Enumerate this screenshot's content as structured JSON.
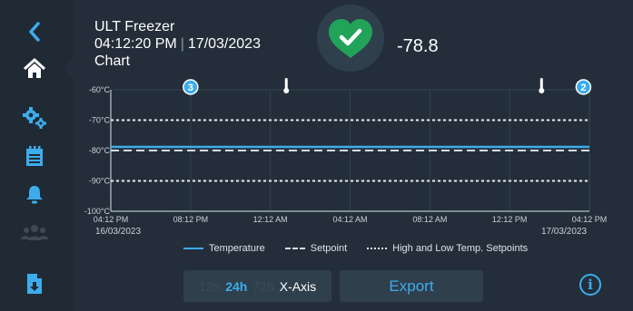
{
  "header": {
    "device_name": "ULT Freezer",
    "time": "04:12:20 PM",
    "separator": "|",
    "date": "17/03/2023",
    "page_title": "Chart"
  },
  "status": {
    "icon": "check-icon",
    "color": "#21a35a",
    "reading": "-78.8"
  },
  "sidebar": {
    "items": [
      {
        "name": "back",
        "icon": "chevron-left-icon"
      },
      {
        "name": "home",
        "icon": "home-icon",
        "active": true
      },
      {
        "name": "settings",
        "icon": "gears-icon"
      },
      {
        "name": "calendar",
        "icon": "calendar-icon"
      },
      {
        "name": "alarms",
        "icon": "bell-icon"
      },
      {
        "name": "users",
        "icon": "users-icon",
        "disabled": true
      },
      {
        "name": "export-report",
        "icon": "file-download-icon"
      }
    ]
  },
  "colors": {
    "accent": "#3dacec",
    "temperature_line": "#3dacec",
    "setpoint_line": "#d7dde3",
    "limits_line": "#e6eaee",
    "disabled": "#3f4a56"
  },
  "chart_data": {
    "type": "line",
    "x_ticks": [
      "04:12 PM",
      "08:12 PM",
      "12:12 AM",
      "04:12 AM",
      "08:12 AM",
      "12:12 PM",
      "04:12 PM"
    ],
    "x_dates": [
      "16/03/2023",
      "17/03/2023"
    ],
    "y_ticks": [
      "-60°C",
      "-70°C",
      "-80°C",
      "-90°C",
      "-100°C"
    ],
    "ylim": [
      -100,
      -60
    ],
    "series": [
      {
        "name": "Temperature",
        "style": "solid",
        "y": [
          -78.8,
          -78.8
        ]
      },
      {
        "name": "Setpoint",
        "style": "dashed",
        "y": [
          -80,
          -80
        ]
      },
      {
        "name": "High and Low Temp. Setpoints",
        "style": "dotted",
        "y": [
          -70,
          -90
        ]
      }
    ],
    "markers": [
      {
        "type": "badge",
        "text": "3",
        "x_hours": 4
      },
      {
        "type": "thermometer",
        "x_hours": 8.8
      },
      {
        "type": "thermometer",
        "x_hours": 21.6
      },
      {
        "type": "badge",
        "text": "2",
        "x_hours": 23.7
      }
    ]
  },
  "x_axis_control": {
    "options": [
      "12h",
      "24h",
      "72h"
    ],
    "selected": "24h",
    "label": "X-Axis"
  },
  "export_label": "Export",
  "info_icon": "info-icon"
}
